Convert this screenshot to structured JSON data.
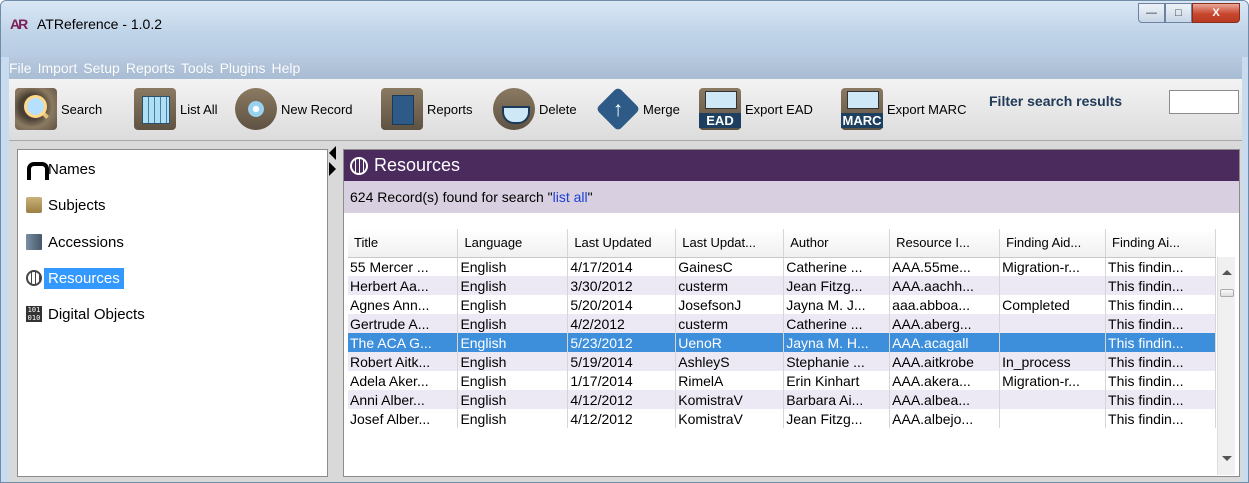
{
  "window": {
    "title": "ATReference - 1.0.2",
    "logo_text": "AR",
    "controls": {
      "minimize": "—",
      "maximize": "□",
      "close": "X"
    }
  },
  "menubar": [
    "File",
    "Import",
    "Setup",
    "Reports",
    "Tools",
    "Plugins",
    "Help"
  ],
  "toolbar": {
    "buttons": [
      {
        "label": "Search",
        "icon": "search-icon"
      },
      {
        "label": "List All",
        "icon": "list-all-icon"
      },
      {
        "label": "New Record",
        "icon": "new-record-icon"
      },
      {
        "label": "Reports",
        "icon": "reports-icon"
      },
      {
        "label": "Delete",
        "icon": "delete-icon"
      },
      {
        "label": "Merge",
        "icon": "merge-icon"
      },
      {
        "label": "Export EAD",
        "icon": "export-ead-icon",
        "badge": "EAD"
      },
      {
        "label": "Export MARC",
        "icon": "export-marc-icon",
        "badge": "MARC"
      }
    ],
    "filter_label": "Filter search results",
    "filter_value": ""
  },
  "sidebar": {
    "items": [
      {
        "label": "Names",
        "icon": "names-icon",
        "selected": false
      },
      {
        "label": "Subjects",
        "icon": "subjects-folder-icon",
        "selected": false
      },
      {
        "label": "Accessions",
        "icon": "accessions-icon",
        "selected": false
      },
      {
        "label": "Resources",
        "icon": "resources-globe-icon",
        "selected": true
      },
      {
        "label": "Digital Objects",
        "icon": "digital-objects-icon",
        "selected": false
      }
    ]
  },
  "panel": {
    "title": "Resources",
    "status_prefix": "624 Record(s) found for search \"",
    "status_query": "list all",
    "status_suffix": "\"",
    "accent_color": "#4b2a5e"
  },
  "table": {
    "columns": [
      "Title",
      "Language",
      "Last Updated",
      "Last Updat...",
      "Author",
      "Resource I...",
      "Finding Aid...",
      "Finding Ai..."
    ],
    "rows": [
      [
        "55 Mercer ...",
        "English",
        "4/17/2014",
        "GainesC",
        "Catherine ...",
        "AAA.55me...",
        "Migration-r...",
        "This findin..."
      ],
      [
        "Herbert Aa...",
        "English",
        "3/30/2012",
        "custerm",
        "Jean Fitzg...",
        "AAA.aachh...",
        "",
        "This findin..."
      ],
      [
        "Agnes Ann...",
        "English",
        "5/20/2014",
        "JosefsonJ",
        "Jayna M. J...",
        "aaa.abboa...",
        "Completed",
        "This findin..."
      ],
      [
        "Gertrude A...",
        "English",
        "4/2/2012",
        "custerm",
        "Catherine ...",
        "AAA.aberg...",
        "",
        "This findin..."
      ],
      [
        "The ACA G...",
        "English",
        "5/23/2012",
        "UenoR",
        "Jayna M. H...",
        "AAA.acagall",
        "",
        "This findin..."
      ],
      [
        "Robert Aitk...",
        "English",
        "5/19/2014",
        "AshleyS",
        "Stephanie ...",
        "AAA.aitkrobe",
        "In_process",
        "This findin..."
      ],
      [
        "Adela Aker...",
        "English",
        "1/17/2014",
        "RimelA",
        "Erin Kinhart",
        "AAA.akera...",
        "Migration-r...",
        "This findin..."
      ],
      [
        "Anni Alber...",
        "English",
        "4/12/2012",
        "KomistraV",
        "Barbara Ai...",
        "AAA.albea...",
        "",
        "This findin..."
      ],
      [
        "Josef Alber...",
        "English",
        "4/12/2012",
        "KomistraV",
        "Jean Fitzg...",
        "AAA.albejo...",
        "",
        "This findin..."
      ]
    ],
    "selected_row": 4
  }
}
